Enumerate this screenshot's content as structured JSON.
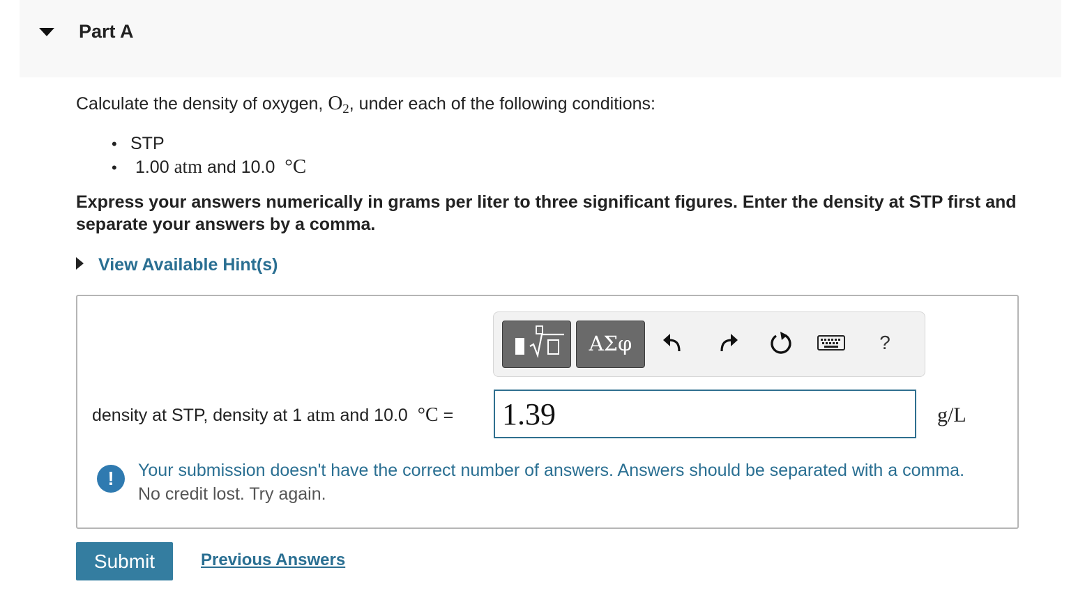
{
  "part": {
    "title": "Part A"
  },
  "question": {
    "prefix": "Calculate the density of oxygen, ",
    "formula_base": "O",
    "formula_sub": "2",
    "suffix": ", under each of the following conditions:",
    "conditions": [
      {
        "text": "STP"
      },
      {
        "num": "1.00",
        "unit1": "atm",
        "mid": "and 10.0",
        "unit2": "°C"
      }
    ],
    "instruction": "Express your answers numerically in grams per liter to three significant figures. Enter the density at STP first and separate your answers by a comma."
  },
  "hints": {
    "label": "View Available Hint(s)"
  },
  "toolbar": {
    "greek_label": "ΑΣφ",
    "help_label": "?",
    "icons": [
      "templates-icon",
      "greek-letters-icon",
      "undo-icon",
      "redo-icon",
      "reset-icon",
      "keyboard-icon",
      "help-icon"
    ]
  },
  "answer": {
    "label_part1": "density at STP, density at 1",
    "label_unit1": "atm",
    "label_part2": "and 10.0",
    "label_unit2": "°C",
    "label_eq": "=",
    "value": "1.39",
    "unit": "g/L"
  },
  "feedback": {
    "icon": "!",
    "message": "Your submission doesn't have the correct number of answers. Answers should be separated with a comma.",
    "sub": "No credit lost. Try again."
  },
  "actions": {
    "submit_label": "Submit",
    "previous_answers_label": "Previous Answers"
  },
  "colors": {
    "accent": "#2a6f92",
    "submit_bg": "#347da0",
    "feedback_icon": "#2f7ab0",
    "toolbar_button": "#6a6a6a"
  }
}
